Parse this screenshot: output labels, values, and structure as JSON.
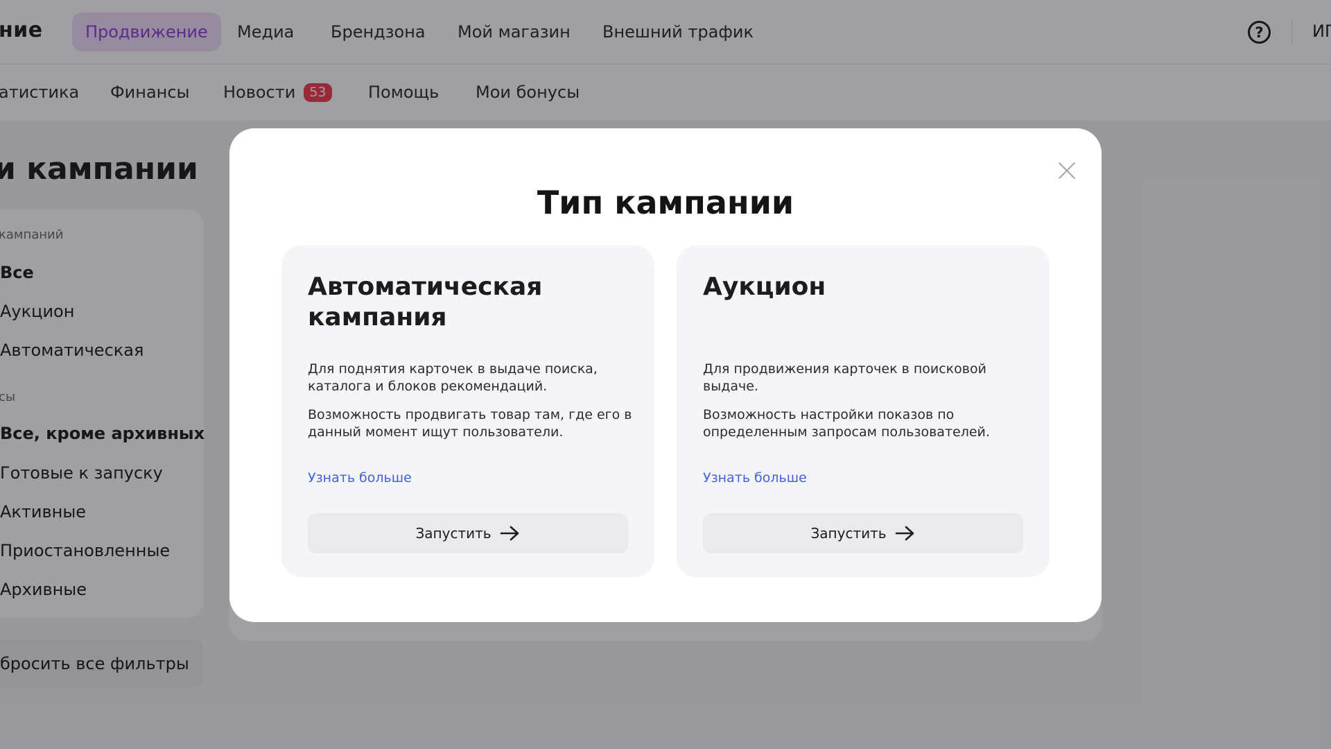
{
  "topnav": {
    "brand_fragment": "ние",
    "items": [
      {
        "label": "Продвижение",
        "active": true
      },
      {
        "label": "Медиа"
      },
      {
        "label": "Брендзона"
      },
      {
        "label": "Мой магазин"
      },
      {
        "label": "Внешний трафик"
      }
    ],
    "help_icon": "question-circle-icon",
    "user_fragment": "ИП"
  },
  "subnav": {
    "items": [
      {
        "label": "атистика"
      },
      {
        "label": "Финансы"
      },
      {
        "label": "Новости",
        "badge": "53"
      },
      {
        "label": "Помощь"
      },
      {
        "label": "Мои бонусы"
      }
    ]
  },
  "page": {
    "title_fragment": "и кампании"
  },
  "filters": {
    "type_label": "кампаний",
    "type_items": [
      "Все",
      "Аукцион",
      "Автоматическая"
    ],
    "status_label": "сы",
    "status_items": [
      "Все, кроме архивных",
      "Готовые к запуску",
      "Активные",
      "Приостановленные",
      "Архивные"
    ],
    "reset_label": "бросить все фильтры"
  },
  "modal": {
    "title": "Тип кампании",
    "close_icon": "close-icon",
    "cards": [
      {
        "title": "Автоматическая кампания",
        "desc1": "Для поднятия карточек в выдаче поиска, каталога и блоков рекомендаций.",
        "desc2": "Возможность продвигать товар там, где его в данный момент ищут пользователи.",
        "learn_more": "Узнать больше",
        "launch": "Запустить",
        "arrow_icon": "arrow-right-icon"
      },
      {
        "title": "Аукцион",
        "desc1": "Для продвижения карточек в поисковой выдаче.",
        "desc2": "Возможность настройки показов по определенным запросам пользователей.",
        "learn_more": "Узнать больше",
        "launch": "Запустить",
        "arrow_icon": "arrow-right-icon"
      }
    ]
  },
  "colors": {
    "accent": "#8c3fd6",
    "accent_bg": "#eeddfb",
    "badge": "#f0394f",
    "link": "#3f63dd",
    "overlay": "#121216"
  }
}
